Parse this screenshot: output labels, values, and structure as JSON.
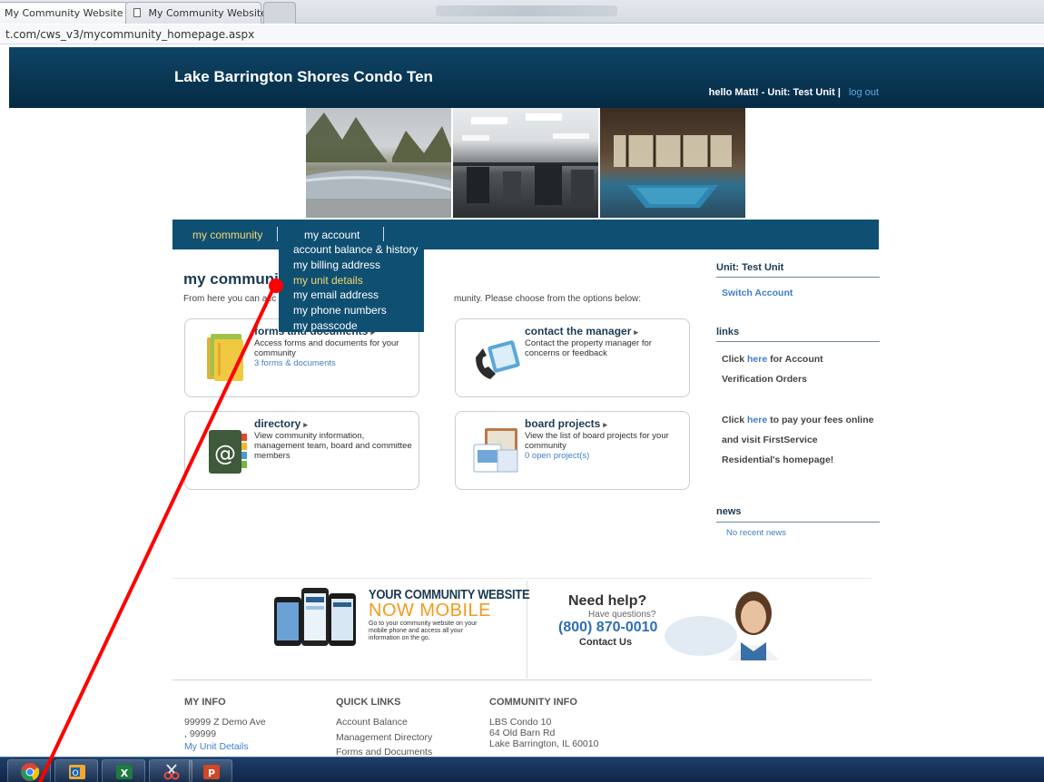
{
  "browser": {
    "tabs": [
      {
        "title": "My Community Website",
        "close": "×"
      },
      {
        "title": "My Community Website",
        "close": "×"
      }
    ],
    "url": "t.com/cws_v3/mycommunity_homepage.aspx"
  },
  "header": {
    "site_title": "Lake Barrington Shores Condo Ten",
    "greeting": "hello  Matt! - Unit: Test Unit  |",
    "logout": "log out"
  },
  "nav": {
    "items": [
      {
        "label": "my community"
      },
      {
        "label": "my account"
      }
    ],
    "separator": "|"
  },
  "account_menu": {
    "items": [
      {
        "label": "account balance & history"
      },
      {
        "label": "my billing address"
      },
      {
        "label": "my unit details"
      },
      {
        "label": "my email address"
      },
      {
        "label": "my phone numbers"
      },
      {
        "label": "my passcode"
      }
    ]
  },
  "main": {
    "heading": "my communit",
    "desc_left": "From here you can acc",
    "desc_right": "munity. Please choose from the options below:",
    "cards": [
      {
        "title": "forms and documents",
        "arrow": "▸",
        "desc": "Access forms and documents for your community",
        "link": "3 forms & documents",
        "icon": "folder-icon"
      },
      {
        "title": "contact the manager",
        "arrow": "▸",
        "desc": "Contact the property manager for concerns or feedback",
        "link": "",
        "icon": "phone-icon"
      },
      {
        "title": "directory",
        "arrow": "▸",
        "desc": "View community information, management team, board and committee members",
        "link": "",
        "icon": "address-book-icon"
      },
      {
        "title": "board projects",
        "arrow": "▸",
        "desc": "View the list of board projects for your community",
        "link": "0 open project(s)",
        "icon": "projects-icon"
      }
    ]
  },
  "sidebar": {
    "unit_heading": "Unit: Test Unit",
    "switch_account": "Switch Account",
    "links_heading": "links",
    "link1_pre": "Click ",
    "link1_here": "here",
    "link1_post": " for Account Verification Orders",
    "link2_pre": "Click ",
    "link2_here": "here",
    "link2_post": " to pay your fees online and visit FirstService Residential's homepage!",
    "news_heading": "news",
    "news_empty": "No recent news"
  },
  "promo": {
    "mobile_title": "YOUR COMMUNITY WEBSITE",
    "mobile_subtitle": "NOW MOBILE",
    "mobile_desc": "Go to your community website on your mobile phone and access all your information on the go.",
    "help_title": "Need help?",
    "help_question": "Have questions?",
    "help_phone": "(800) 870-0010",
    "help_contact": "Contact Us"
  },
  "footer": {
    "my_info": {
      "heading": "MY INFO",
      "line1": "99999 Z Demo Ave",
      "line2": ", 99999",
      "link": "My Unit Details"
    },
    "quick_links": {
      "heading": "QUICK LINKS",
      "items": [
        "Account Balance",
        "Management Directory",
        "Forms and Documents"
      ]
    },
    "community_info": {
      "heading": "COMMUNITY INFO",
      "line1": "LBS Condo 10",
      "line2": "64 Old Barn Rd",
      "line3": "Lake Barrington, IL 60010"
    }
  },
  "colors": {
    "header_bg": "#062a44",
    "nav_bg": "#0f4f72",
    "menu_highlight": "#f1d970",
    "link": "#3f7fc4",
    "mobile_accent": "#f39a1d",
    "annotation": "#ff0000"
  },
  "taskbar": {
    "icons": [
      "chrome-icon",
      "outlook-icon",
      "excel-icon",
      "snipping-tool-icon",
      "powerpoint-icon"
    ]
  }
}
